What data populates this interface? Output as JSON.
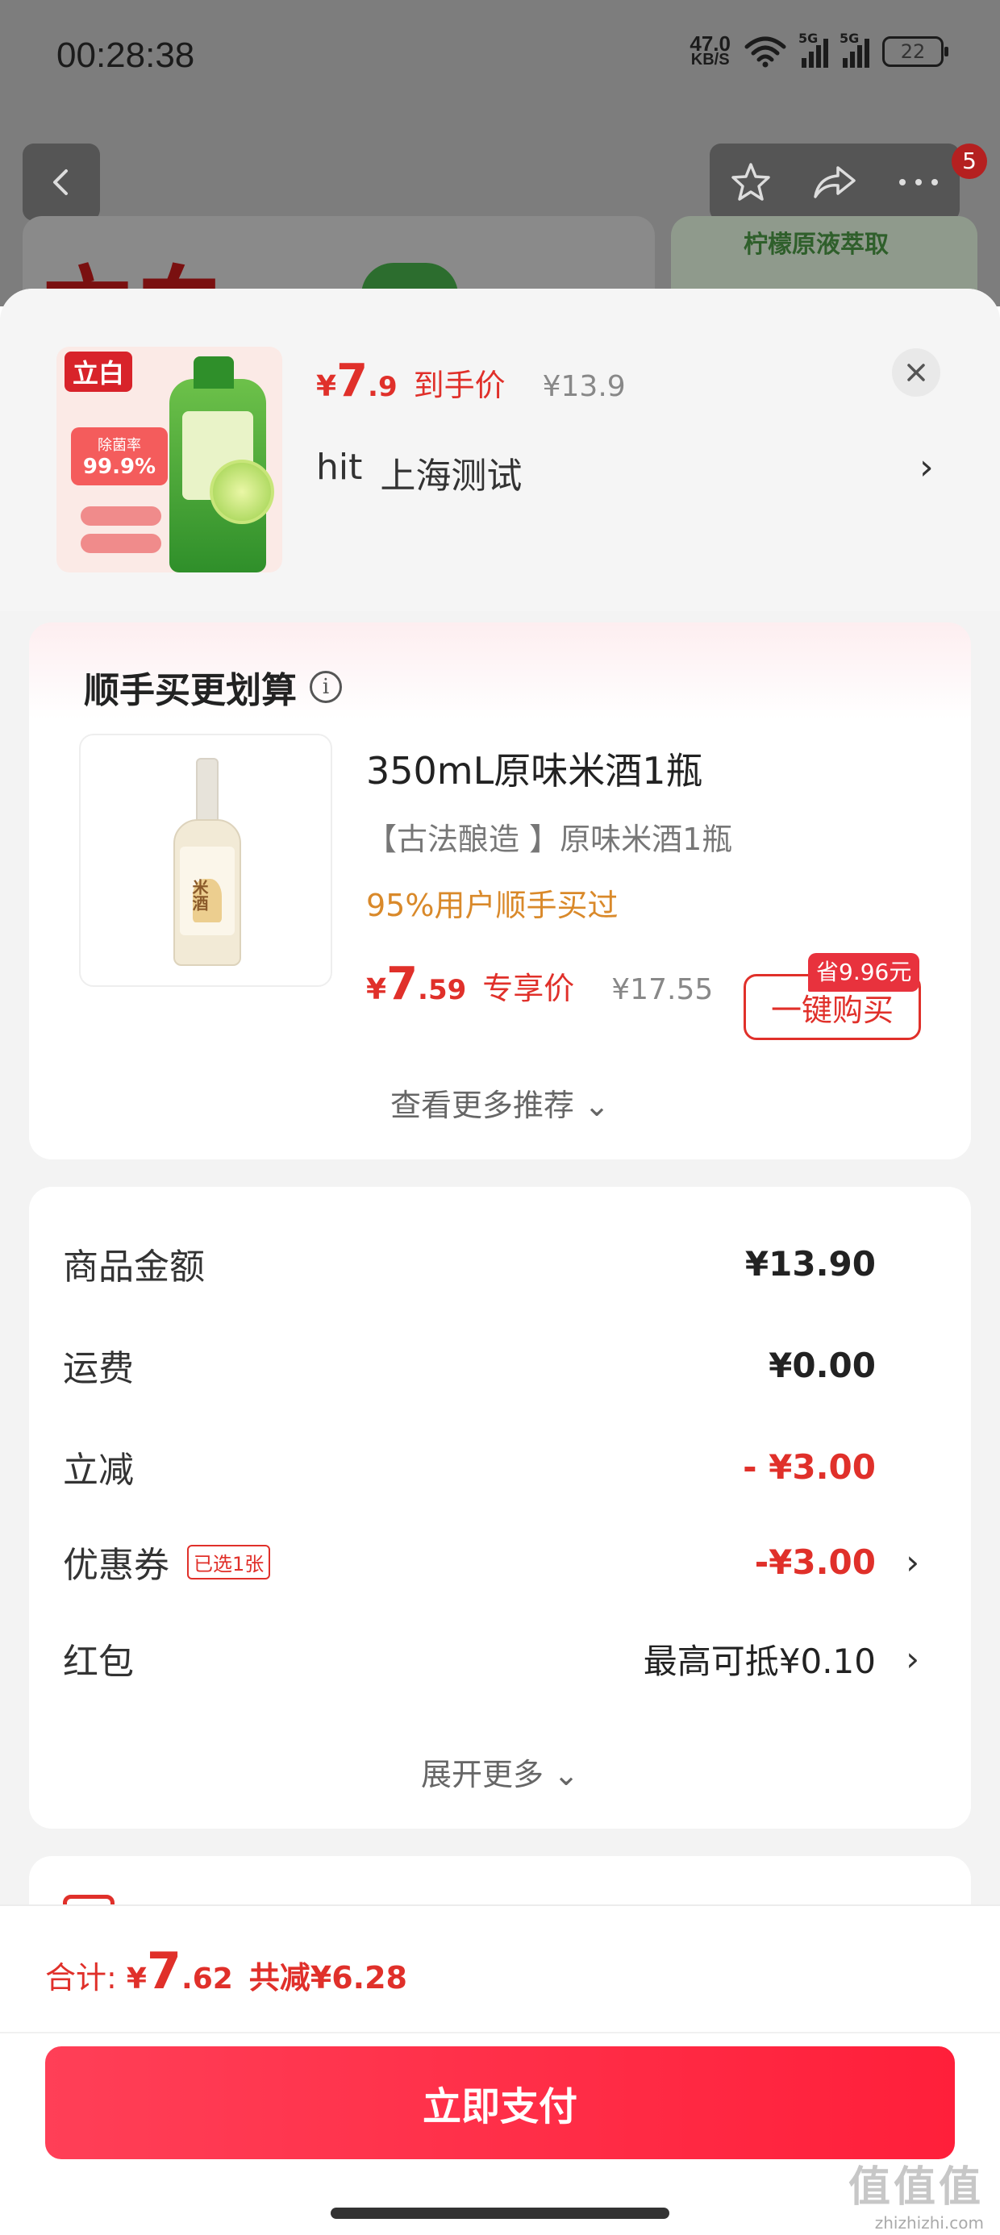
{
  "status_bar": {
    "time": "00:28:38",
    "net_speed_value": "47.0",
    "net_speed_unit": "KB/S",
    "signal1_label": "5G",
    "signal2_label": "5G",
    "battery": "22"
  },
  "background_page": {
    "notification_count": "5",
    "brand_logo": "立白",
    "banner_text": "柠檬原液萃取",
    "icons": [
      "back-icon",
      "star-icon",
      "share-icon",
      "more-icon"
    ]
  },
  "order_header": {
    "product_logo": "立白",
    "product_tag_small": "除菌率",
    "product_tag_big": "99.9%",
    "price_currency": "¥",
    "price_int": "7",
    "price_dec": ".9",
    "price_label": "到手价",
    "original_price": "¥13.9",
    "address_name": "hit",
    "address_location": "上海测试",
    "chevron": "›",
    "close_icon": "×"
  },
  "upsell": {
    "title": "顺手买更划算",
    "info_icon": "i",
    "product_name": "350mL原味米酒1瓶",
    "product_desc": "【古法酿造 】原味米酒1瓶",
    "purchase_stat": "95%用户顺手买过",
    "price_currency": "¥",
    "price_int": "7",
    "price_dec": ".59",
    "price_label": "专享价",
    "original_price": "¥17.55",
    "buy_button": "一键购买",
    "save_badge": "省9.96元",
    "bottle_label": "米酒",
    "more_label": "查看更多推荐 ⌄"
  },
  "price_details": {
    "rows": [
      {
        "label": "商品金额",
        "value": "¥13.90"
      },
      {
        "label": "运费",
        "value": "¥0.00"
      },
      {
        "label": "立减",
        "value": "- ¥3.00"
      },
      {
        "label": "优惠券",
        "chip": "已选1张",
        "value": "-¥3.00",
        "chevron": "›"
      },
      {
        "label": "红包",
        "value": "最高可抵¥0.10",
        "chevron": "›"
      }
    ],
    "expand_label": "展开更多 ⌄"
  },
  "footer": {
    "total_label": "合计:",
    "total_currency": "¥",
    "total_int": "7",
    "total_dec": ".62",
    "saved_text": "共减¥6.28",
    "pay_button": "立即支付",
    "watermark_logo": "值值值",
    "watermark_url": "zhizhizhi.com"
  },
  "colors": {
    "accent_red": "#e0302a",
    "pay_button": "#ff1f3a",
    "stat_orange": "#d9892a",
    "muted_gray": "#888888"
  }
}
